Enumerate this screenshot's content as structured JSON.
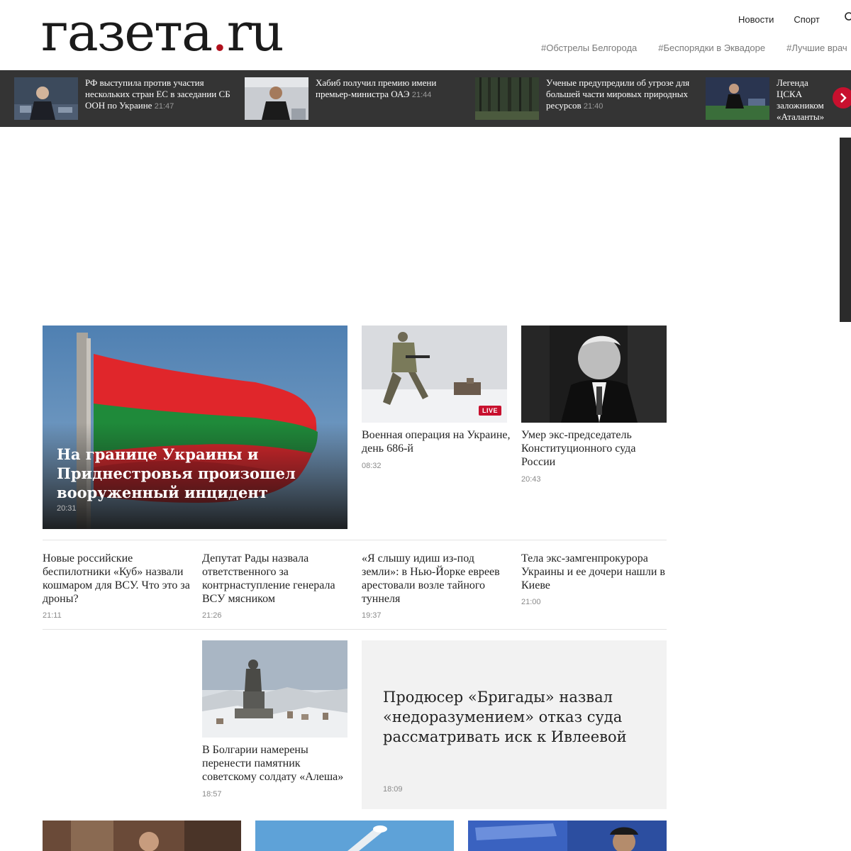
{
  "header": {
    "logo_main": "газета",
    "logo_dot": ".",
    "logo_tld": "ru",
    "nav": [
      "Новости",
      "Спорт"
    ],
    "tags": [
      "#Обстрелы Белгорода",
      "#Беспорядки в Эквадоре",
      "#Лучшие врач"
    ]
  },
  "ticker": [
    {
      "title": "РФ выступила против участия нескольких стран ЕС в заседании СБ ООН по Украине",
      "time": "21:47"
    },
    {
      "title": "Хабиб получил премию имени премьер-министра ОАЭ",
      "time": "21:44"
    },
    {
      "title": "Ученые предупредили об угрозе для большей части мировых природных ресурсов",
      "time": "21:40"
    },
    {
      "title": "Легенда ЦСКА заложником «Аталанты»",
      "time": ""
    }
  ],
  "featured": {
    "title": "На границе Украины и Приднестровья произошел вооруженный инцидент",
    "time": "20:31"
  },
  "cards": [
    {
      "title": "Военная операция на Украине, день 686-й",
      "time": "08:32",
      "badge": "LIVE"
    },
    {
      "title": "Умер экс-председатель Конституционного суда России",
      "time": "20:43"
    }
  ],
  "text_news": [
    {
      "title": "Новые российские беспилотники «Куб» назвали кошмаром для ВСУ. Что это за дроны?",
      "time": "21:11"
    },
    {
      "title": "Депутат Рады назвала ответственного за контрнаступление генерала ВСУ мясником",
      "time": "21:26"
    },
    {
      "title": "«Я слышу идиш из-под земли»: в Нью-Йорке евреев арестовали возле тайного туннеля",
      "time": "19:37"
    },
    {
      "title": "Тела экс-замгенпрокурора Украины и ее дочери нашли в Киеве",
      "time": "21:00"
    }
  ],
  "bulgaria": {
    "title": "В Болгарии намерены перенести памятник советскому солдату «Алеша»",
    "time": "18:57"
  },
  "grey_card": {
    "title": "Продюсер «Бригады» назвал «недоразумением» отказ суда рассматривать иск к Ивлеевой",
    "time": "18:09"
  },
  "colors": {
    "accent": "#c8102e",
    "ticker_bg": "#343434",
    "tag": "#7a7a7a"
  }
}
